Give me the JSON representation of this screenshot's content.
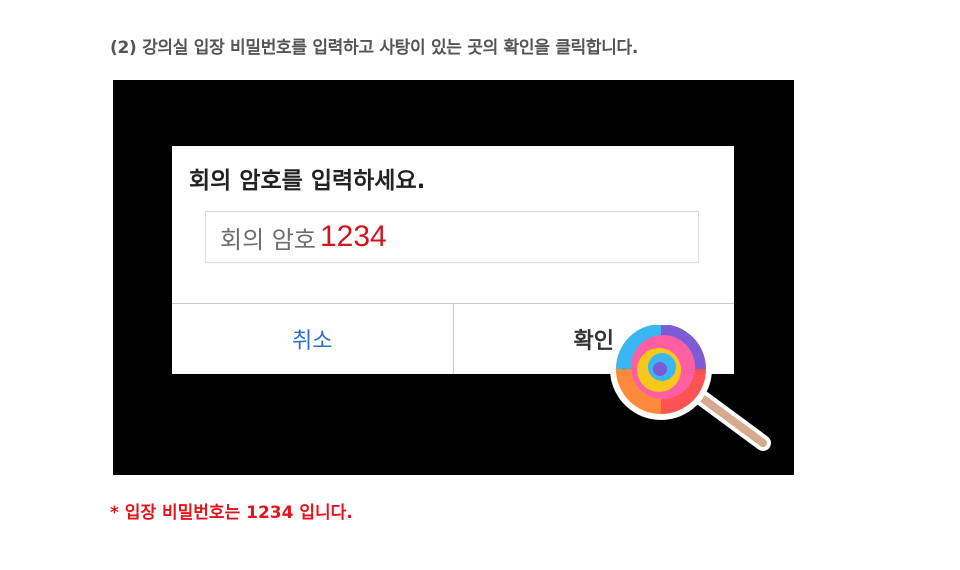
{
  "instruction": {
    "text": "(2) 강의실 입장 비밀번호를 입력하고 사탕이 있는 곳의 확인을 클릭합니다."
  },
  "dialog": {
    "title": "회의 암호를 입력하세요.",
    "password_placeholder": "회의 암호",
    "password_value": "1234",
    "cancel_label": "취소",
    "confirm_label": "확인"
  },
  "note": {
    "text": "* 입장 비밀번호는 1234 입니다."
  },
  "colors": {
    "screen_background": "#000000",
    "cancel_text": "#2a6fc9",
    "password_value": "#d0151c",
    "note_text": "#e5141c"
  },
  "icons": {
    "pointer": "lollipop-icon"
  }
}
